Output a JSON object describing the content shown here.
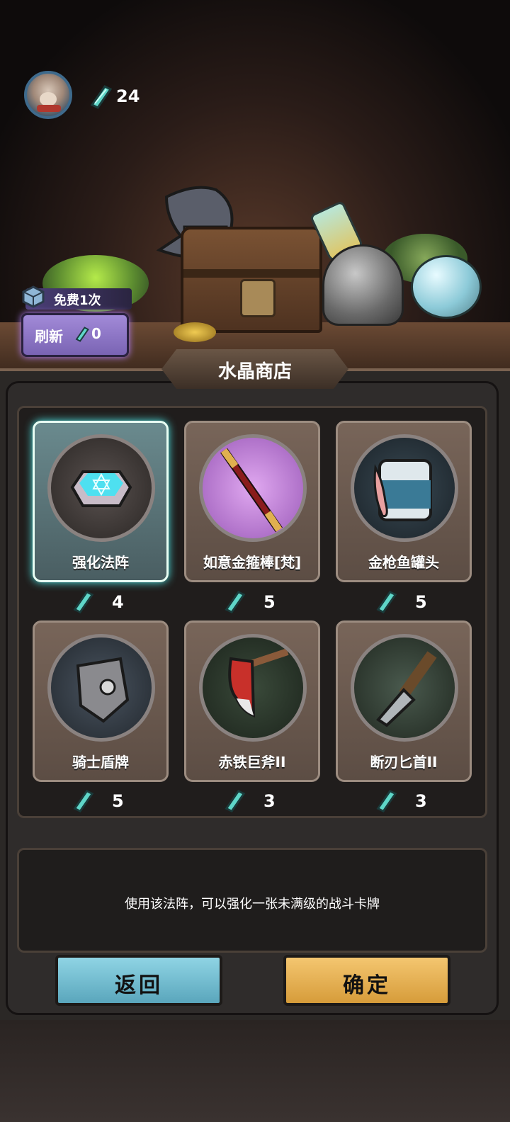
{
  "header": {
    "crystal_count": "24"
  },
  "refresh": {
    "free_label": "免费1次",
    "button_label": "刷新",
    "cost": "0"
  },
  "shop": {
    "title": "水晶商店",
    "items": [
      {
        "name": "强化法阵",
        "price": "4",
        "selected": true,
        "icon": "magic-circle-icon"
      },
      {
        "name": "如意金箍棒[梵]",
        "price": "5",
        "selected": false,
        "icon": "golden-staff-icon"
      },
      {
        "name": "金枪鱼罐头",
        "price": "5",
        "selected": false,
        "icon": "tuna-can-icon"
      },
      {
        "name": "骑士盾牌",
        "price": "5",
        "selected": false,
        "icon": "knight-shield-icon"
      },
      {
        "name": "赤铁巨斧II",
        "price": "3",
        "selected": false,
        "icon": "red-iron-axe-icon"
      },
      {
        "name": "断刃匕首II",
        "price": "3",
        "selected": false,
        "icon": "broken-dagger-icon"
      }
    ],
    "description": "使用该法阵，可以强化一张未满级的战斗卡牌"
  },
  "buttons": {
    "back": "返回",
    "confirm": "确定"
  },
  "colors": {
    "crystal": "#5fd6c8",
    "confirm": "#e8b052",
    "back": "#74bed2",
    "refresh": "#9580cc"
  }
}
